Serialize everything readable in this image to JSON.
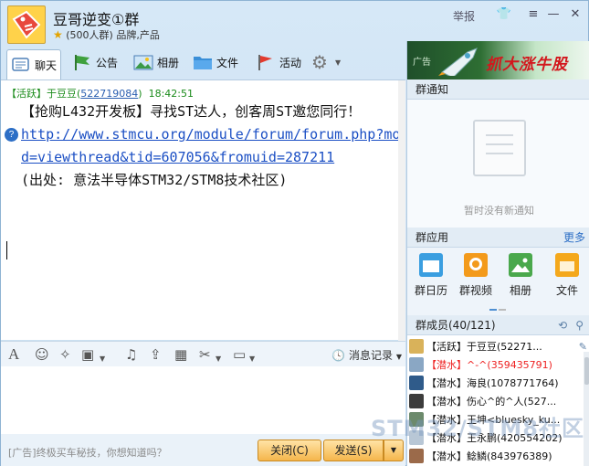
{
  "window": {
    "title": "豆哥逆变①群",
    "subtitle": "(500人群) 品牌,产品",
    "report_label": "举报"
  },
  "toolbar": {
    "tabs": [
      {
        "label": "聊天",
        "icon": "chat-icon"
      },
      {
        "label": "公告",
        "icon": "announcement-icon"
      },
      {
        "label": "相册",
        "icon": "album-icon"
      },
      {
        "label": "文件",
        "icon": "folder-icon"
      },
      {
        "label": "活动",
        "icon": "flag-icon"
      }
    ]
  },
  "message": {
    "status": "【活跃】",
    "sender": "于豆豆",
    "uid": "522719084",
    "time": "18:42:51",
    "text": "【抢购L432开发板】寻找ST达人，创客周ST邀您同行！",
    "link": "http://www.stmcu.org/module/forum/forum.php?mod=viewthread&tid=607056&fromuid=287211",
    "source": "(出处: 意法半导体STM32/STM8技术社区)"
  },
  "format_bar": {
    "history_label": "消息记录"
  },
  "bottom": {
    "ad_text": "[广告]终极买车秘技，你想知道吗？",
    "close_label": "关闭(C)",
    "send_label": "发送(S)"
  },
  "right_panel": {
    "banner_ad": "广告",
    "banner_slogan": "抓大涨牛股",
    "notice_title": "群通知",
    "notice_empty": "暂时没有新通知",
    "apps_title": "群应用",
    "apps_more": "更多",
    "apps": [
      {
        "label": "群日历",
        "icon": "calendar-icon",
        "color": "#3a9ee0"
      },
      {
        "label": "群视频",
        "icon": "video-icon",
        "color": "#f39a1b"
      },
      {
        "label": "相册",
        "icon": "photo-icon",
        "color": "#4aa84c"
      },
      {
        "label": "文件",
        "icon": "file-icon",
        "color": "#f4a81c"
      }
    ],
    "members_title": "群成员(40/121)",
    "members": [
      {
        "text": "【活跃】于豆豆(52271...",
        "red": false
      },
      {
        "text": "【潜水】^-^(359435791)",
        "red": true
      },
      {
        "text": "【潜水】海良(1078771764)",
        "red": false
      },
      {
        "text": "【潜水】伤心^的^人(527...",
        "red": false
      },
      {
        "text": "【潜水】王坤<bluesky_ku...",
        "red": false
      },
      {
        "text": "【潜水】王永鹏(420554202)",
        "red": false
      },
      {
        "text": "【潜水】鲶鳞(843976389)",
        "red": false
      }
    ]
  },
  "watermark": "STM32/STM8社区",
  "colors": {
    "accent": "#2d6fc6",
    "active_green": "#1a8b1a",
    "red": "#e22222",
    "button": "#f5b64c"
  }
}
